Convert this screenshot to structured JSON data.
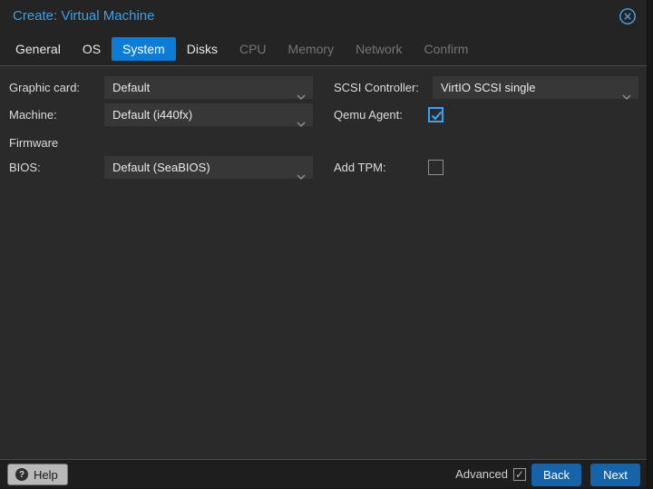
{
  "window": {
    "title": "Create: Virtual Machine"
  },
  "tabs": {
    "items": [
      {
        "label": "General",
        "state": "enabled"
      },
      {
        "label": "OS",
        "state": "enabled"
      },
      {
        "label": "System",
        "state": "active"
      },
      {
        "label": "Disks",
        "state": "enabled"
      },
      {
        "label": "CPU",
        "state": "disabled"
      },
      {
        "label": "Memory",
        "state": "disabled"
      },
      {
        "label": "Network",
        "state": "disabled"
      },
      {
        "label": "Confirm",
        "state": "disabled"
      }
    ]
  },
  "form": {
    "left": {
      "graphic_card": {
        "label": "Graphic card:",
        "value": "Default"
      },
      "machine": {
        "label": "Machine:",
        "value": "Default (i440fx)"
      },
      "firmware_section": "Firmware",
      "bios": {
        "label": "BIOS:",
        "value": "Default (SeaBIOS)"
      }
    },
    "right": {
      "scsi_controller": {
        "label": "SCSI Controller:",
        "value": "VirtIO SCSI single"
      },
      "qemu_agent": {
        "label": "Qemu Agent:",
        "checked": true
      },
      "add_tpm": {
        "label": "Add TPM:",
        "checked": false
      }
    }
  },
  "footer": {
    "help_label": "Help",
    "help_icon_glyph": "?",
    "advanced_label": "Advanced",
    "advanced_checked": true,
    "back_label": "Back",
    "next_label": "Next"
  },
  "icons": {
    "close": "circle-x-icon",
    "dropdown": "chevron-down-icon"
  },
  "colors": {
    "title_blue": "#3f9fe0",
    "active_tab_blue": "#0d7cd6",
    "button_blue": "#1563a8",
    "checkbox_blue": "#3fa0e8",
    "dialog_bg": "#2a2a2a",
    "field_bg": "#373737"
  }
}
